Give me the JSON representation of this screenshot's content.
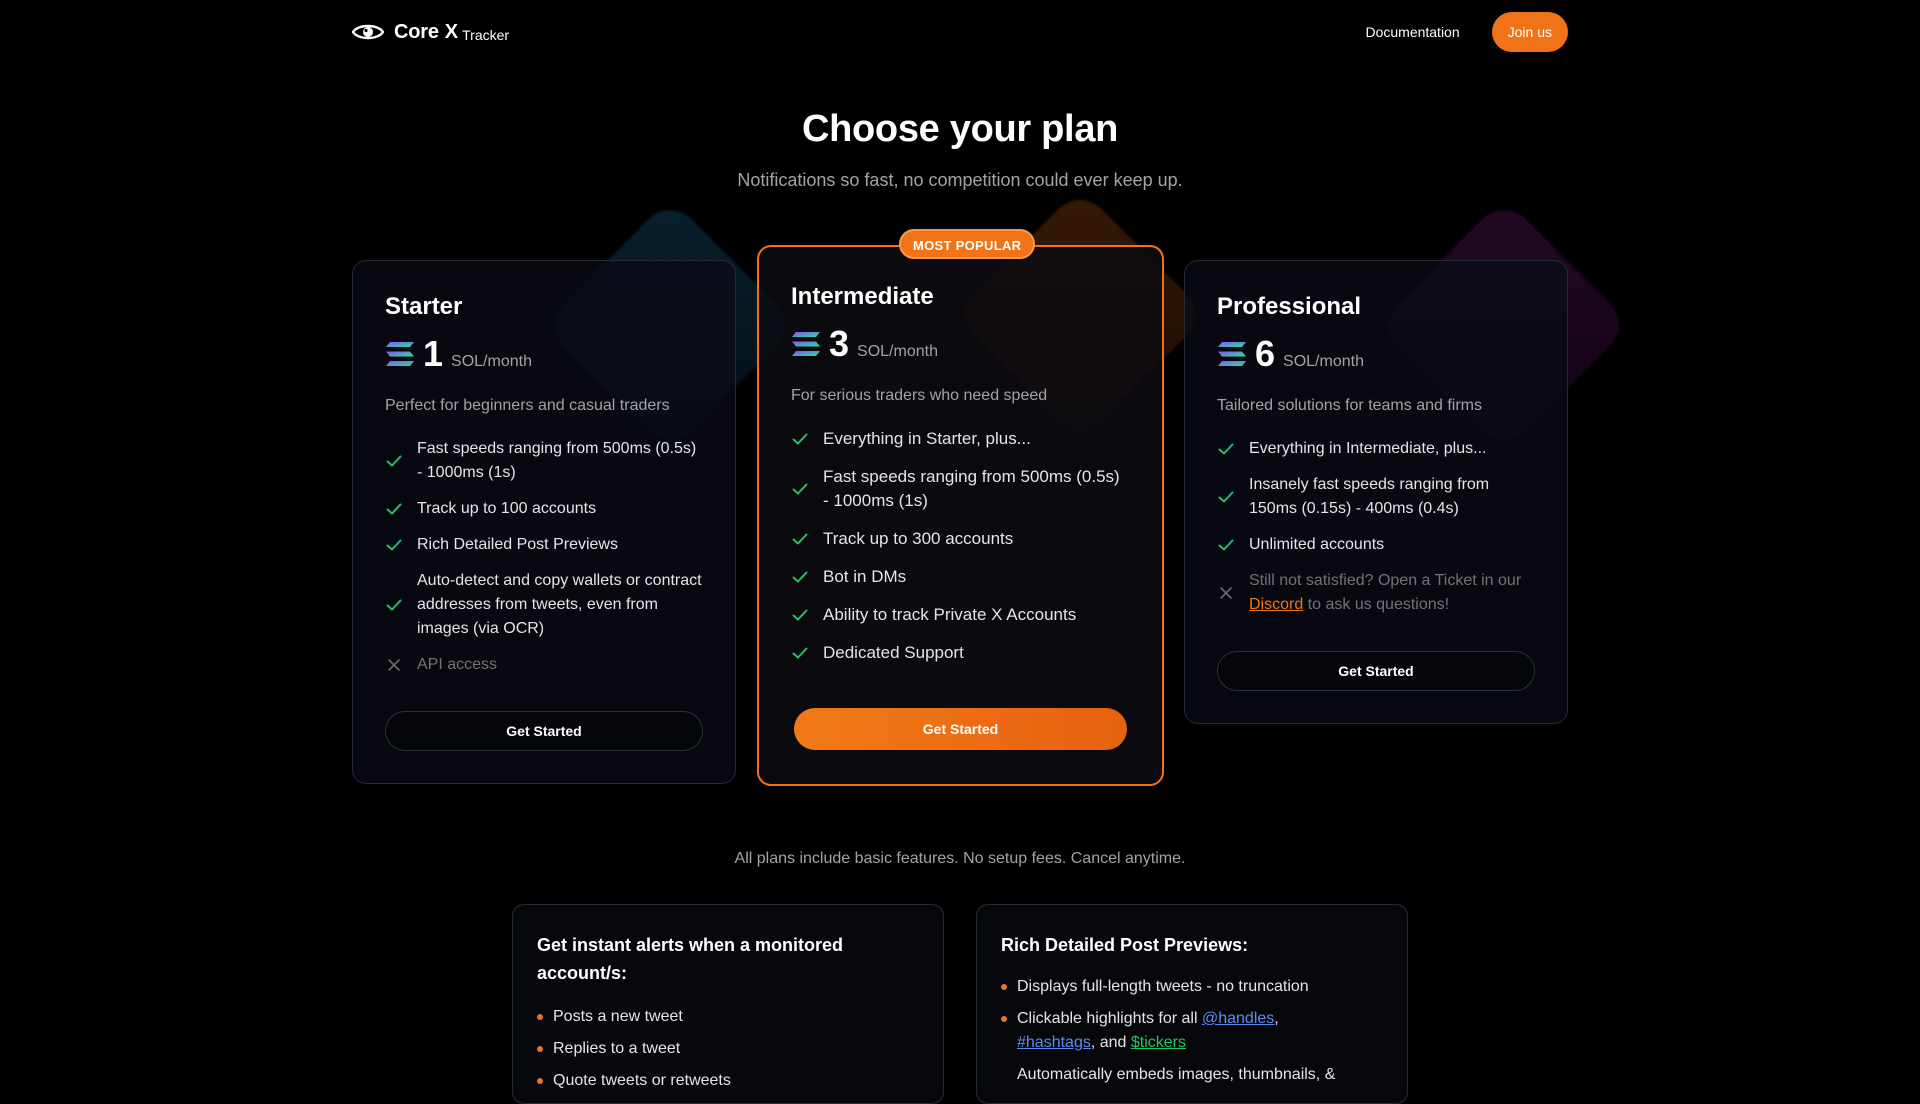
{
  "header": {
    "brand_core": "Core",
    "brand_x": "X",
    "brand_tracker": "Tracker",
    "nav_documentation": "Documentation",
    "join_label": "Join us"
  },
  "hero": {
    "title": "Choose your plan",
    "subtitle": "Notifications so fast, no competition could ever keep up."
  },
  "colors": {
    "accent": "#f07417",
    "check": "#22c55e",
    "muted": "#a3a3a3",
    "background": "#000000"
  },
  "plans": [
    {
      "name": "Starter",
      "price": "1",
      "unit": "SOL/month",
      "description": "Perfect for beginners and casual traders",
      "features": [
        {
          "text": "Fast speeds ranging from 500ms (0.5s) - 1000ms (1s)",
          "included": true
        },
        {
          "text": "Track up to 100 accounts",
          "included": true
        },
        {
          "text": "Rich Detailed Post Previews",
          "included": true
        },
        {
          "text": "Auto-detect and copy wallets or contract addresses from tweets, even from images (via OCR)",
          "included": true
        },
        {
          "text": "API access",
          "included": false
        }
      ],
      "cta": "Get Started"
    },
    {
      "name": "Intermediate",
      "badge": "MOST POPULAR",
      "price": "3",
      "unit": "SOL/month",
      "description": "For serious traders who need speed",
      "features": [
        {
          "text": "Everything in Starter, plus...",
          "included": true
        },
        {
          "text": "Fast speeds ranging from 500ms (0.5s) - 1000ms (1s)",
          "included": true
        },
        {
          "text": "Track up to 300 accounts",
          "included": true
        },
        {
          "text": "Bot in DMs",
          "included": true
        },
        {
          "text": "Ability to track Private X Accounts",
          "included": true
        },
        {
          "text": "Dedicated Support",
          "included": true
        }
      ],
      "cta": "Get Started"
    },
    {
      "name": "Professional",
      "price": "6",
      "unit": "SOL/month",
      "description": "Tailored solutions for teams and firms",
      "features": [
        {
          "text": "Everything in Intermediate, plus...",
          "included": true
        },
        {
          "text": "Insanely fast speeds ranging from 150ms (0.15s) - 400ms (0.4s)",
          "included": true
        },
        {
          "text": "Unlimited accounts",
          "included": true
        }
      ],
      "ticket": {
        "before": "Still not satisfied? Open a Ticket in our ",
        "link": "Discord",
        "after": " to ask us questions!",
        "included": false
      },
      "cta": "Get Started"
    }
  ],
  "footer_note": "All plans include basic features. No setup fees. Cancel anytime.",
  "info_cards": {
    "alerts": {
      "title": "Get instant alerts when a monitored account/s:",
      "items": [
        "Posts a new tweet",
        "Replies to a tweet",
        "Quote tweets or retweets"
      ]
    },
    "previews": {
      "title": "Rich Detailed Post Previews:",
      "item1": "Displays full-length tweets - no truncation",
      "item2": {
        "before": "Clickable highlights for all ",
        "handles": "@handles",
        "sep1": ",",
        "hashtags": "#hashtags",
        "sep2": ", and ",
        "tickers": "$tickers"
      },
      "item3": "Automatically embeds images, thumbnails, &"
    }
  }
}
